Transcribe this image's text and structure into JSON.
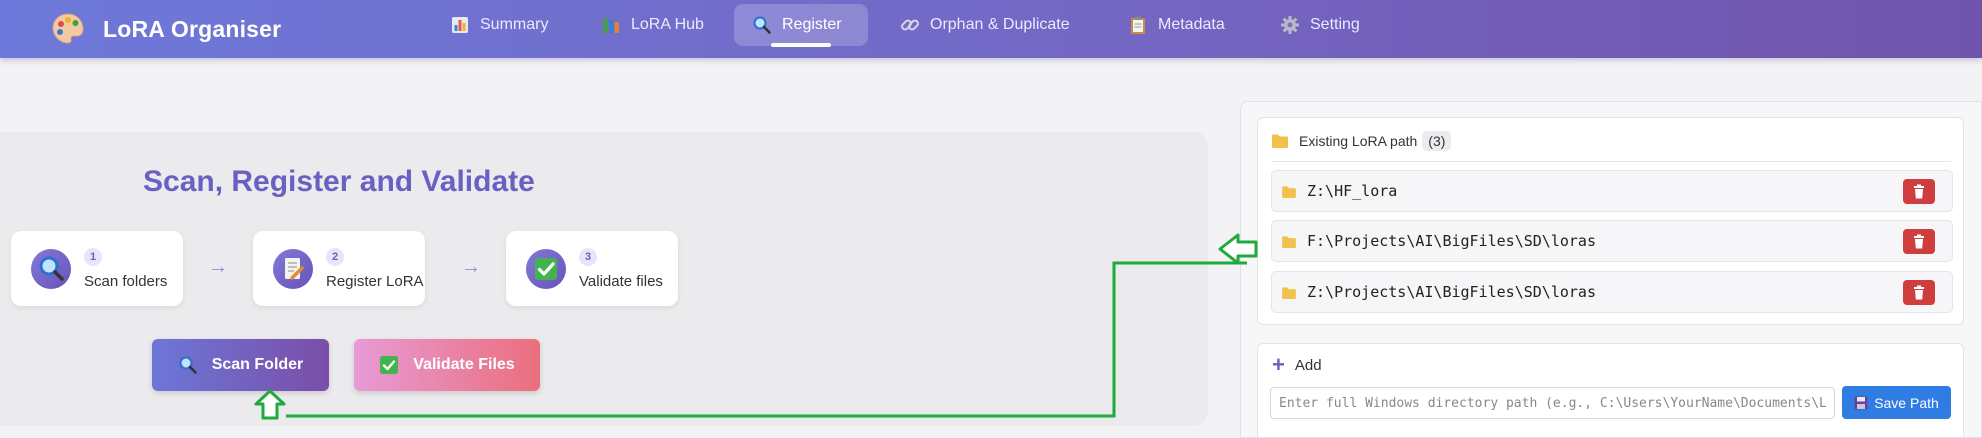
{
  "app": {
    "title": "LoRA Organiser",
    "icon": "palette-icon"
  },
  "nav": {
    "tabs": [
      {
        "label": "Summary",
        "icon": "bar-chart-icon",
        "active": false
      },
      {
        "label": "LoRA Hub",
        "icon": "books-icon",
        "active": false
      },
      {
        "label": "Register",
        "icon": "magnifier-icon",
        "active": true
      },
      {
        "label": "Orphan & Duplicate",
        "icon": "link-icon",
        "active": false
      },
      {
        "label": "Metadata",
        "icon": "clipboard-icon",
        "active": false
      },
      {
        "label": "Setting",
        "icon": "gear-icon",
        "active": false
      }
    ]
  },
  "main": {
    "heading": "Scan, Register and Validate",
    "steps": [
      {
        "number": "1",
        "label": "Scan folders",
        "icon": "magnifier-icon"
      },
      {
        "number": "2",
        "label": "Register LoRA",
        "icon": "memo-icon"
      },
      {
        "number": "3",
        "label": "Validate files",
        "icon": "check-mark-icon"
      }
    ],
    "arrow": "→",
    "buttons": {
      "scan": "Scan Folder",
      "validate": "Validate Files"
    }
  },
  "paths": {
    "title": "Existing LoRA path",
    "count": "(3)",
    "items": [
      "Z:\\HF_lora",
      "F:\\Projects\\AI\\BigFiles\\SD\\loras",
      "Z:\\Projects\\AI\\BigFiles\\SD\\loras"
    ]
  },
  "add": {
    "label": "Add",
    "placeholder": "Enter full Windows directory path (e.g., C:\\Users\\YourName\\Documents\\LoRA)",
    "save_label": "Save Path"
  },
  "colors": {
    "nav_gradient": [
      "#6d79da",
      "#7054ac"
    ],
    "accent": "#6a60c4",
    "scan_button": [
      "#6c77d8",
      "#7a4ea8"
    ],
    "validate_button": [
      "#e89ad6",
      "#ea6f7c"
    ],
    "delete_button": "#cf3e3e",
    "save_button": "#2f7de2",
    "annotation_arrow": "#1faa3c"
  }
}
